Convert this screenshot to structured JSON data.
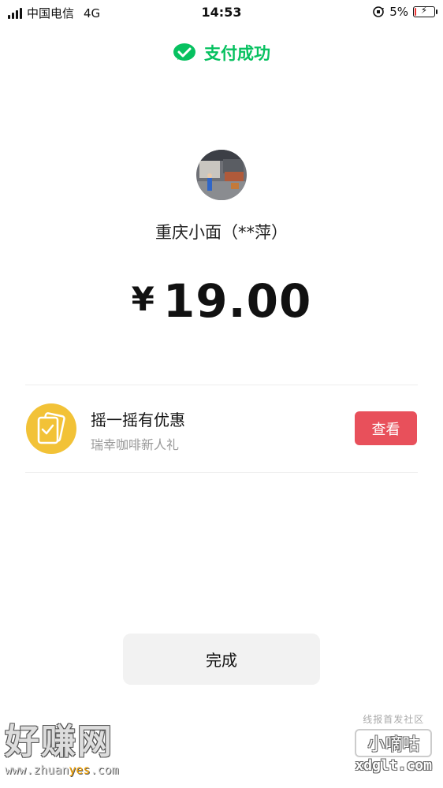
{
  "status_bar": {
    "carrier": "中国电信",
    "network": "4G",
    "time": "14:53",
    "battery_percent": "5%",
    "battery_level": 0.05,
    "icons": [
      "signal-icon",
      "orientation-lock-icon",
      "battery-charging-icon"
    ]
  },
  "header": {
    "title": "支付成功",
    "icon": "wechat-pay-icon",
    "accent": "#07c160"
  },
  "merchant": {
    "name": "重庆小面（**萍）"
  },
  "payment": {
    "currency_symbol": "¥",
    "amount": "19.00"
  },
  "promo": {
    "title": "摇一摇有优惠",
    "subtitle": "瑞幸咖啡新人礼",
    "button": "查看",
    "icon": "coupon-cards-icon",
    "icon_color": "#f2c237",
    "button_color": "#e8505b"
  },
  "footer": {
    "done_label": "完成"
  },
  "watermarks": {
    "left_title": "好赚网",
    "left_url_a": "www.zhuan",
    "left_url_b": "yes",
    "left_url_c": ".com",
    "right_top": "线报首发社区",
    "right_mid": "小嘀咕",
    "right_url": "xdglt.com"
  }
}
